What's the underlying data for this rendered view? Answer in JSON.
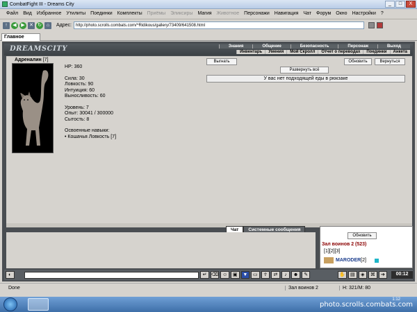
{
  "window": {
    "title": "CombatFight III - Dreams City",
    "controls": [
      "_",
      "□",
      "X"
    ]
  },
  "menu": {
    "items": [
      {
        "label": "Файл",
        "disabled": false
      },
      {
        "label": "Вид",
        "disabled": false
      },
      {
        "label": "Избранное",
        "disabled": false
      },
      {
        "label": "Утилиты",
        "disabled": false
      },
      {
        "label": "Поединки",
        "disabled": false
      },
      {
        "label": "Комплекты",
        "disabled": false
      },
      {
        "label": "Приёмы",
        "disabled": true
      },
      {
        "label": "Эликсиры",
        "disabled": true
      },
      {
        "label": "Магия",
        "disabled": false
      },
      {
        "label": "Животное",
        "disabled": true
      },
      {
        "label": "Персонажи",
        "disabled": false
      },
      {
        "label": "Навигация",
        "disabled": false
      },
      {
        "label": "Чат",
        "disabled": false
      },
      {
        "label": "Форум",
        "disabled": false
      },
      {
        "label": "Окно",
        "disabled": false
      },
      {
        "label": "Настройки",
        "disabled": false
      },
      {
        "label": "?",
        "disabled": false
      }
    ]
  },
  "address": {
    "label": "Адрес:",
    "url": "http://photo.scrolls.combats.com/^Ridikous/gallery/73409/641508.html"
  },
  "tab": {
    "label": "Главное"
  },
  "header": {
    "logo": "DREAMSCITY",
    "nav_row1": [
      "Знания",
      "Общение",
      "Безопасность",
      "Персонаж",
      "Выход"
    ],
    "nav_row2": [
      "Инвентарь",
      "Умения",
      "Мой Скролл",
      "Отчет о переводах",
      "Поединки",
      "Анкета"
    ]
  },
  "pet": {
    "name": "Адреналин",
    "level": "[7]",
    "hp": "HP: 360",
    "strength": "Сила: 30",
    "agility": "Ловкость: 90",
    "intuition": "Интуиция: 60",
    "endurance": "Выносливость: 60",
    "level_line": "Уровень: 7",
    "exp": "Опыт: 30041 / 300000",
    "satiety": "Сытость: 8",
    "skills_title": "Освоенные навыки:",
    "skill1": "• Кошачья Ловкость [7]"
  },
  "actions": {
    "kick_out": "Выгнать",
    "refresh": "Обновить",
    "back": "Вернуться",
    "expand_all": "Развернуть всё",
    "no_food_msg": "У вас нет подходящей еды в рюкзаке"
  },
  "chat": {
    "tab_chat": "Чат",
    "tab_system": "Системные сообщения",
    "clock": "00:12"
  },
  "sidebar": {
    "refresh": "Обновить",
    "room": "Зал воинов 2 (523)",
    "pages": "[1][2][3]",
    "user_name": "MARODER",
    "user_level": "[2]"
  },
  "status": {
    "done": "Done",
    "room": "Зал воинов 2",
    "hm": "H: 321/M: 80"
  },
  "taskbar": {
    "watermark": "photo.scrolls.combats.com",
    "time": "1:12"
  }
}
